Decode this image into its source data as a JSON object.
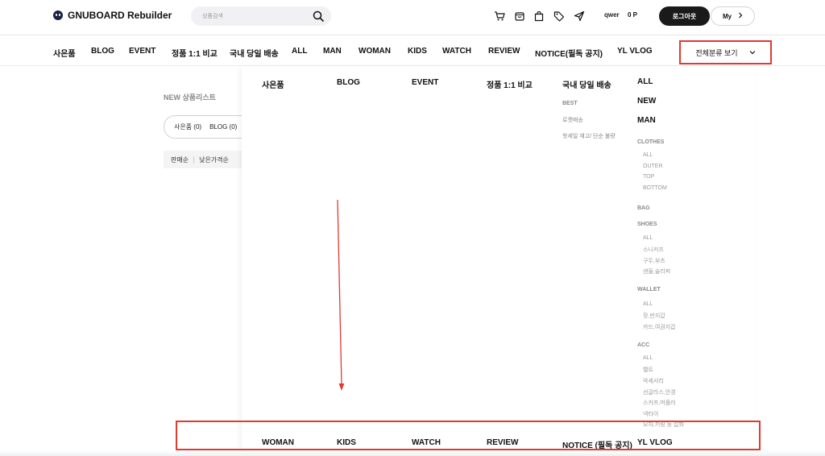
{
  "header": {
    "logo_text": "GNUBOARD Rebuilder",
    "search_placeholder": "상품검색",
    "user_id": "qwer",
    "points": "0 P",
    "logout_label": "로그아웃",
    "my_label": "My",
    "icons": [
      "cart-icon",
      "bag-icon",
      "shopping-bag-icon",
      "tag-icon",
      "paper-plane-icon"
    ]
  },
  "nav": {
    "items": [
      "사은품",
      "BLOG",
      "EVENT",
      "정품 1:1 비교",
      "국내 당일 배송",
      "ALL",
      "MAN",
      "WOMAN",
      "KIDS",
      "WATCH",
      "REVIEW",
      "NOTICE(필독 공지)",
      "YL VLOG"
    ],
    "all_categories_label": "전체분류 보기"
  },
  "background": {
    "list_title": "NEW 상품리스트",
    "tab1": "사은품 (0)",
    "tab2": "BLOG (0)",
    "sort1": "판매순",
    "sort2": "낮은가격순"
  },
  "mega": {
    "columns": [
      "사은품",
      "BLOG",
      "EVENT",
      "정품 1:1 비교",
      "국내 당일 배송"
    ],
    "domestic_subs": [
      "BEST",
      "로켓배송",
      "핫세일 재고/ 단순 불량"
    ],
    "all_col": {
      "head_all": "ALL",
      "head_new": "NEW",
      "head_man": "MAN",
      "clothes": {
        "title": "CLOTHES",
        "items": [
          "ALL",
          "OUTER",
          "TOP",
          "BOTTOM"
        ]
      },
      "bag": "BAG",
      "shoes": {
        "title": "SHOES",
        "items": [
          "ALL",
          "스니커즈",
          "구두,부츠",
          "샌들,슬리퍼"
        ]
      },
      "wallet": {
        "title": "WALLET",
        "items": [
          "ALL",
          "장,반지갑",
          "카드,여권지갑"
        ]
      },
      "acc": {
        "title": "ACC",
        "items": [
          "ALL",
          "벨트",
          "악세서리",
          "선글라스,안경",
          "스카프,머플러",
          "넥타이",
          "모자,키링 등 잡화"
        ]
      }
    },
    "bottom_row": [
      "WOMAN",
      "KIDS",
      "WATCH",
      "REVIEW",
      "NOTICE (필독 공지)",
      "YL VLOG"
    ]
  },
  "colors": {
    "annotation": "#e03a2e",
    "primary_button": "#1a1a1a"
  }
}
